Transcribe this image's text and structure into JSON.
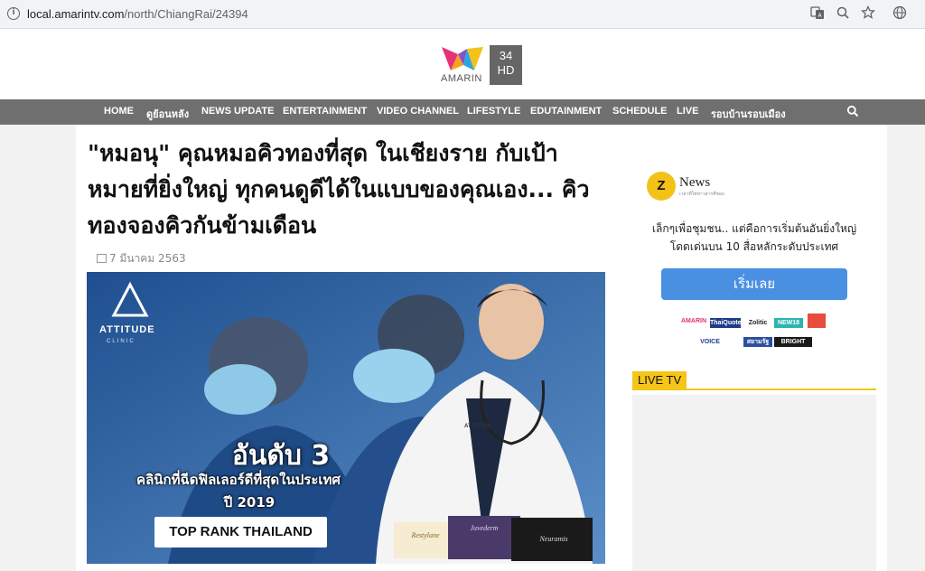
{
  "browser": {
    "url_domain": "local.amarintv.com",
    "url_path": "/north/ChiangRai/24394"
  },
  "header": {
    "logo_text": "AMARIN",
    "channel_number": "34",
    "channel_hd": "HD"
  },
  "nav": {
    "items": [
      "HOME",
      "ดูย้อนหลัง",
      "NEWS UPDATE",
      "ENTERTAINMENT",
      "VIDEO CHANNEL",
      "LIFESTYLE",
      "EDUTAINMENT",
      "SCHEDULE",
      "LIVE",
      "รอบบ้านรอบเมือง"
    ]
  },
  "article": {
    "title": "\"หมอนุ\" คุณหมอคิวทองที่สุด ในเชียงราย กับเป้าหมายที่ยิ่งใหญ่ ทุกคนดูดีได้ในแบบของคุณเอง... คิวทองจองคิวกันข้ามเดือน",
    "date": "7 มีนาคม 2563",
    "hero": {
      "brand": "ATTITUDE",
      "brand_sub": "CLINIC",
      "rank": "อันดับ 3",
      "rank_line2": "คลินิกที่ฉีดฟิลเลอร์ดีที่สุดในประเทศ",
      "rank_year": "ปี 2019",
      "badge": "TOP RANK THAILAND",
      "coat_logo": "ATTITUDE",
      "box1": "Restylane",
      "box2": "Juvederm",
      "box3": "Neuramis"
    }
  },
  "sidebar": {
    "ad_logo_z": "Z",
    "ad_logo_news": "News",
    "ad_logo_sub": "เวลาที่ใช่ข่าวสารที่ชอบ",
    "ad_text_line1": "เล็กๆเพื่อชุมชน.. แต่คือการเริ่มต้นอันยิ่งใหญ่",
    "ad_text_line2": "โดดเด่นบน 10 สื่อหลักระดับประเทศ",
    "ad_button": "เริ่มเลย",
    "partners": [
      "AMARIN",
      "ThaiQuote",
      "Zolitic",
      "NEW18",
      "VOICE",
      "สยามรัฐ",
      "BRIGHT"
    ],
    "live_label": "LIVE TV"
  },
  "colors": {
    "nav_bg": "#6f6f6f",
    "live_accent": "#f5c518",
    "cta_blue": "#4a90e2"
  }
}
